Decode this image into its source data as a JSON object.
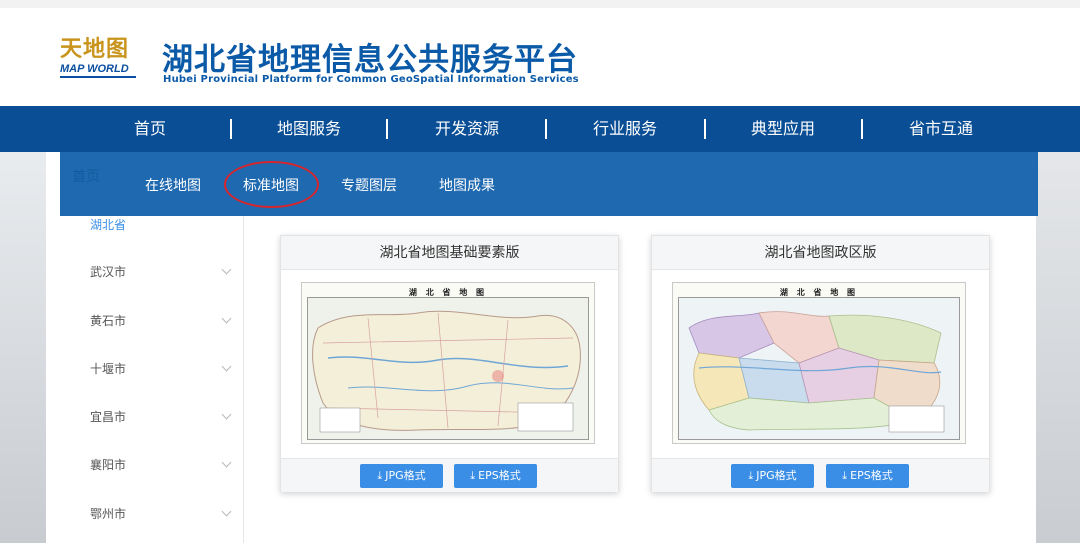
{
  "header": {
    "logo_cn": "天地图",
    "logo_en": "MAP WORLD",
    "title_cn": "湖北省地理信息公共服务平台",
    "title_en": "Hubei Provincial Platform for Common GeoSpatial Information Services"
  },
  "nav": {
    "items": [
      "首页",
      "地图服务",
      "开发资源",
      "行业服务",
      "典型应用",
      "省市互通"
    ]
  },
  "breadcrumb": {
    "home": "首页"
  },
  "subnav": {
    "items": [
      "在线地图",
      "标准地图",
      "专题图层",
      "地图成果"
    ],
    "highlighted": "标准地图"
  },
  "sidebar": {
    "items": [
      {
        "label": "湖北省",
        "active": true
      },
      {
        "label": "武汉市"
      },
      {
        "label": "黄石市"
      },
      {
        "label": "十堰市"
      },
      {
        "label": "宜昌市"
      },
      {
        "label": "襄阳市"
      },
      {
        "label": "鄂州市"
      }
    ]
  },
  "cards": [
    {
      "title": "湖北省地图基础要素版",
      "map_title": "湖 北 省 地 图",
      "btn_jpg": "JPG格式",
      "btn_eps": "EPS格式"
    },
    {
      "title": "湖北省地图政区版",
      "map_title": "湖 北 省 地 图",
      "btn_jpg": "JPG格式",
      "btn_eps": "EPS格式"
    }
  ],
  "colors": {
    "nav_bg": "#0a4f96",
    "brand_blue": "#0b5aa8",
    "accent": "#3a8ee6",
    "highlight_circle": "#d8262c"
  },
  "icons": {
    "download": "download-icon",
    "chevron": "chevron-down-icon"
  }
}
